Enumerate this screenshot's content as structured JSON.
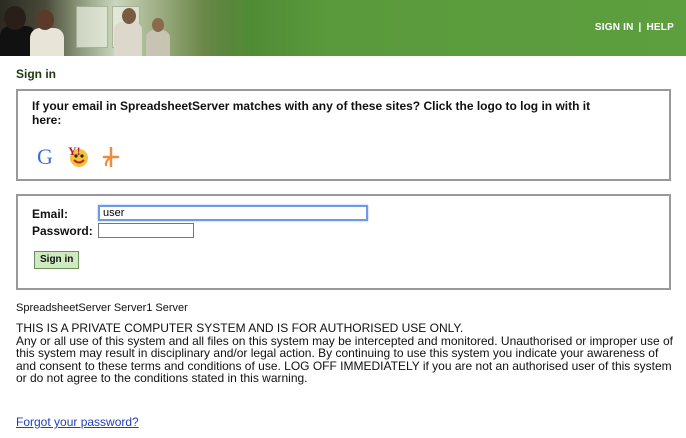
{
  "header": {
    "sign_in_link": "SIGN IN",
    "separator": "|",
    "help_link": "HELP"
  },
  "page_title": "Sign in",
  "oauth": {
    "prompt": "If your email in SpreadsheetServer matches with any of these sites? Click the logo to log in with it here:",
    "providers": [
      {
        "name": "Google",
        "glyph": "G",
        "icon": "google-logo"
      },
      {
        "name": "Yahoo",
        "glyph": "Y!",
        "icon": "yahoo-logo"
      },
      {
        "name": "myOpenID",
        "glyph": "+",
        "icon": "myopenid-logo"
      }
    ]
  },
  "login_form": {
    "email_label": "Email:",
    "email_value": "user",
    "password_label": "Password:",
    "password_value": "",
    "submit_label": "Sign in"
  },
  "server_name": "SpreadsheetServer Server1 Server",
  "warning": {
    "title": "THIS IS A PRIVATE COMPUTER SYSTEM AND IS FOR AUTHORISED USE ONLY.",
    "body": "Any or all use of this system and all files on this system may be intercepted and monitored. Unauthorised or improper use of this system may result in disciplinary and/or legal action. By continuing to use this system you indicate your awareness of and consent to these terms and conditions of use. LOG OFF IMMEDIATELY if you are not an authorised user of this system or do not agree to the conditions stated in this warning."
  },
  "forgot_password": "Forgot your password?",
  "colors": {
    "banner_green": "#5d9e3f",
    "heading_green": "#1d3a12",
    "button_bg": "#cfeac0",
    "link_blue": "#1f3fbf"
  }
}
